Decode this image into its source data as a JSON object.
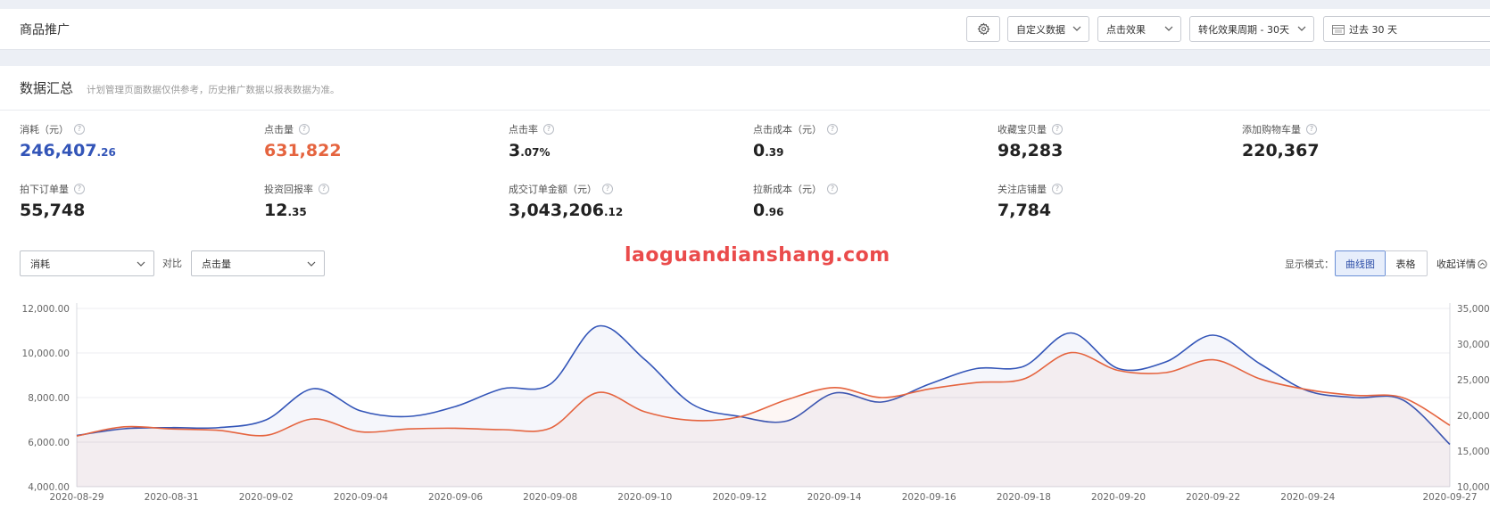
{
  "topbar": {
    "title": "商品推广",
    "settings_icon": "gear-icon",
    "custom_data": "自定义数据",
    "click_effect": "点击效果",
    "conversion_period": "转化效果周期 - 30天",
    "date_range": "过去 30 天"
  },
  "summary": {
    "title": "数据汇总",
    "note": "计划管理页面数据仅供参考，历史推广数据以报表数据为准。",
    "metrics": [
      {
        "label": "消耗（元）",
        "int": "246,407",
        "dec": ".26"
      },
      {
        "label": "点击量",
        "int": "631,822",
        "dec": ""
      },
      {
        "label": "点击率",
        "int": "3",
        "dec": ".07%"
      },
      {
        "label": "点击成本（元）",
        "int": "0",
        "dec": ".39"
      },
      {
        "label": "收藏宝贝量",
        "int": "98,283",
        "dec": ""
      },
      {
        "label": "添加购物车量",
        "int": "220,367",
        "dec": ""
      },
      {
        "label": "拍下订单量",
        "int": "55,748",
        "dec": ""
      },
      {
        "label": "投资回报率",
        "int": "12",
        "dec": ".35"
      },
      {
        "label": "成交订单金额（元）",
        "int": "3,043,206",
        "dec": ".12"
      },
      {
        "label": "拉新成本（元）",
        "int": "0",
        "dec": ".96"
      },
      {
        "label": "关注店铺量",
        "int": "7,784",
        "dec": ""
      }
    ]
  },
  "controls": {
    "metric_a": "消耗",
    "compare_label": "对比",
    "metric_b": "点击量",
    "watermark": "laoguandianshang.com",
    "display_mode_label": "显示模式：",
    "mode_line": "曲线图",
    "mode_table": "表格",
    "collapse": "收起详情"
  },
  "colors": {
    "primary_series": "#3355b8",
    "secondary_series": "#e5643f"
  },
  "chart_data": {
    "type": "line",
    "x_ticks": [
      "2020-08-29",
      "2020-08-31",
      "2020-09-02",
      "2020-09-04",
      "2020-09-06",
      "2020-09-08",
      "2020-09-10",
      "2020-09-12",
      "2020-09-14",
      "2020-09-16",
      "2020-09-18",
      "2020-09-20",
      "2020-09-22",
      "2020-09-24",
      "2020-09-27"
    ],
    "left_axis": {
      "ticks": [
        "4,000.00",
        "6,000.00",
        "8,000.00",
        "10,000.00",
        "12,000.00"
      ],
      "ylim": [
        4000,
        12000
      ]
    },
    "right_axis": {
      "ticks": [
        "10,000",
        "15,000",
        "20,000",
        "25,000",
        "30,000",
        "35,000"
      ],
      "ylim": [
        10000,
        35000
      ]
    },
    "x": [
      "2020-08-29",
      "2020-08-30",
      "2020-08-31",
      "2020-09-01",
      "2020-09-02",
      "2020-09-03",
      "2020-09-04",
      "2020-09-05",
      "2020-09-06",
      "2020-09-07",
      "2020-09-08",
      "2020-09-09",
      "2020-09-10",
      "2020-09-11",
      "2020-09-12",
      "2020-09-13",
      "2020-09-14",
      "2020-09-15",
      "2020-09-16",
      "2020-09-17",
      "2020-09-18",
      "2020-09-19",
      "2020-09-20",
      "2020-09-21",
      "2020-09-22",
      "2020-09-23",
      "2020-09-24",
      "2020-09-25",
      "2020-09-26",
      "2020-09-27"
    ],
    "series": [
      {
        "values": [
          6300,
          6600,
          6650,
          6650,
          7000,
          8400,
          7400,
          7150,
          7600,
          8400,
          8600,
          11200,
          9700,
          7700,
          7150,
          6950,
          8200,
          7800,
          8600,
          9300,
          9400,
          10900,
          9300,
          9600,
          10800,
          9500,
          8300,
          8000,
          7900,
          5900
        ]
      },
      {
        "values": [
          17100,
          18400,
          18100,
          17900,
          17200,
          19500,
          17700,
          18100,
          18200,
          18000,
          18200,
          23200,
          20500,
          19300,
          19800,
          22200,
          23900,
          22500,
          23700,
          24600,
          25100,
          28800,
          26300,
          26000,
          27800,
          25100,
          23600,
          22800,
          22500,
          18600
        ]
      }
    ]
  }
}
